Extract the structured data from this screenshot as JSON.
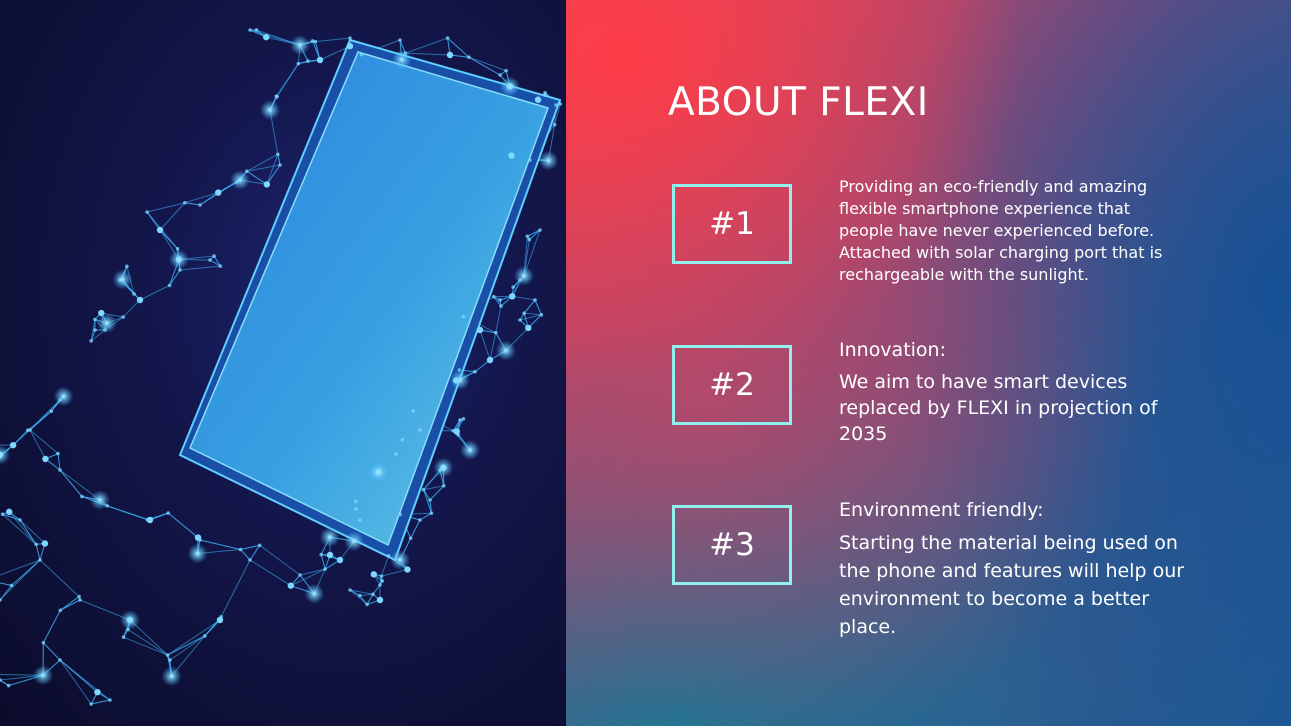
{
  "slide": {
    "title": "ABOUT FLEXI",
    "items": [
      {
        "number": "#1",
        "heading": "",
        "text": "Providing an eco-friendly and amazing flexible smartphone experience that people have never experienced before. Attached with solar charging port that is rechargeable with the sunlight."
      },
      {
        "number": "#2",
        "heading": "Innovation:",
        "text": "We aim to have smart devices replaced by FLEXI in projection of 2035"
      },
      {
        "number": "#3",
        "heading": "Environment friendly:",
        "text": "Starting the material being used on the phone and features will help our environment to become a better place."
      }
    ]
  },
  "colors": {
    "box_border": "#8ff0ee",
    "mesh": "#3fb8ff",
    "phone_screen": "#4fb6e8"
  },
  "image": {
    "icon": "wireframe-hand-holding-phone"
  }
}
